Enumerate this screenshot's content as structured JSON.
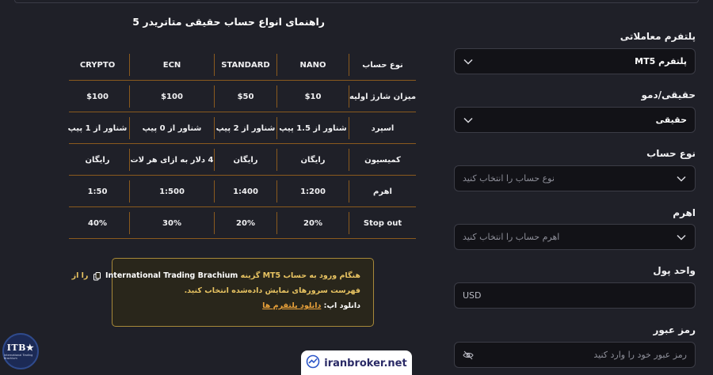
{
  "page": {
    "title": "راهنمای انواع حساب حقیقی متاتریدر 5"
  },
  "form": {
    "platform": {
      "label": "پلتفرم معاملاتی",
      "value": "پلتفرم MT5"
    },
    "account_mode": {
      "label": "حقیقی/دمو",
      "value": "حقیقی"
    },
    "account_type": {
      "label": "نوع حساب",
      "placeholder": "نوع حساب را انتخاب کنید"
    },
    "leverage": {
      "label": "اهرم",
      "placeholder": "اهرم حساب را انتخاب کنید"
    },
    "currency": {
      "label": "واحد پول",
      "value": "USD"
    },
    "password": {
      "label": "رمز عبور",
      "placeholder": "رمز عبور خود را وارد کنید"
    }
  },
  "table": {
    "header": {
      "label": "نوع حساب",
      "cols": [
        "NANO",
        "STANDARD",
        "ECN",
        "CRYPTO"
      ]
    },
    "rows": [
      {
        "label": "میزان شارژ اولیه",
        "cols": [
          "$10",
          "$50",
          "$100",
          "$100"
        ]
      },
      {
        "label": "اسپرد",
        "cols": [
          "شناور از 1.5 پیپ",
          "شناور از 2 پیپ",
          "شناور از 0 پیپ",
          "شناور از 1 پیپ"
        ]
      },
      {
        "label": "کمیسیون",
        "cols": [
          "رایگان",
          "رایگان",
          "4 دلار به ازای هر لات",
          "رایگان"
        ]
      },
      {
        "label": "اهرم",
        "cols": [
          "1:200",
          "1:400",
          "1:500",
          "1:50"
        ]
      },
      {
        "label": "Stop out",
        "cols": [
          "20%",
          "20%",
          "30%",
          "40%"
        ]
      }
    ]
  },
  "notice": {
    "line1_part1": "هنگام ورود به حساب",
    "line1_mt5": "MT5",
    "line1_part2": "گزینه",
    "line1_server": "International Trading Brachium",
    "line1_part3": "را از",
    "line2": "فهرست سرورهای نمایش داده‌شده انتخاب کنید.",
    "line3_label": "دانلود اپ:",
    "line3_link": "دانلود پلتفرم ها"
  },
  "badges": {
    "itb_text": "ITB★",
    "itb_sub": "International Trading Brachium",
    "brand_name": "iranbroker.net"
  },
  "colors": {
    "background": "#1f2028",
    "input_bg": "#121217",
    "table_lines": "#8a5a1e",
    "notice_border": "#a7893a",
    "notice_text": "#e9c462"
  }
}
